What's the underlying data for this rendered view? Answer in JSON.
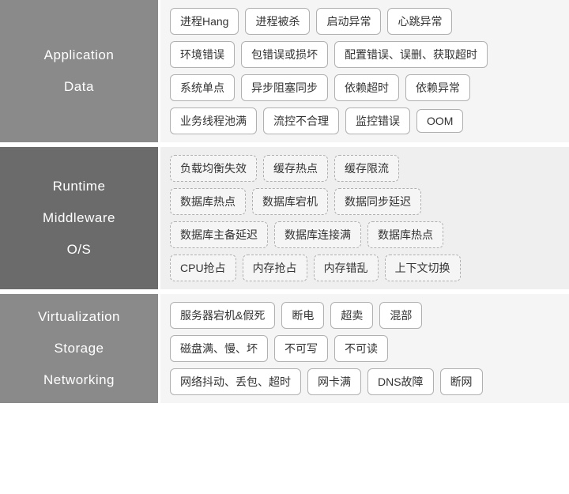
{
  "sections": [
    {
      "id": "app-data",
      "labels": [
        "Application",
        "Data"
      ],
      "labelBg": "#8a8a8a",
      "tagStyle": "solid",
      "contentRows": [
        [
          "进程Hang",
          "进程被杀",
          "启动异常",
          "心跳异常"
        ],
        [
          "环境错误",
          "包错误或损坏",
          "配置错误、误删、获取超时"
        ],
        [
          "系统单点",
          "异步阻塞同步",
          "依赖超时",
          "依赖异常"
        ],
        [
          "业务线程池满",
          "流控不合理",
          "监控错误",
          "OOM"
        ]
      ]
    },
    {
      "id": "runtime-os",
      "labels": [
        "Runtime",
        "Middleware",
        "O/S"
      ],
      "labelBg": "#737373",
      "tagStyle": "dashed",
      "contentRows": [
        [
          "负载均衡失效",
          "缓存热点",
          "缓存限流"
        ],
        [
          "数据库热点",
          "数据库宕机",
          "数据同步延迟"
        ],
        [
          "数据库主备延迟",
          "数据库连接满",
          "数据库热点"
        ],
        [
          "CPU抢占",
          "内存抢占",
          "内存错乱",
          "上下文切换"
        ]
      ]
    },
    {
      "id": "virt-net",
      "labels": [
        "Virtualization",
        "Storage",
        "Networking"
      ],
      "labelBg": "#8a8a8a",
      "tagStyle": "solid",
      "contentRows": [
        [
          "服务器宕机&假死",
          "断电",
          "超卖",
          "混部"
        ],
        [
          "磁盘满、慢、坏",
          "不可写",
          "不可读"
        ],
        [
          "网络抖动、丢包、超时",
          "网卡满",
          "DNS故障",
          "断网"
        ]
      ]
    }
  ]
}
